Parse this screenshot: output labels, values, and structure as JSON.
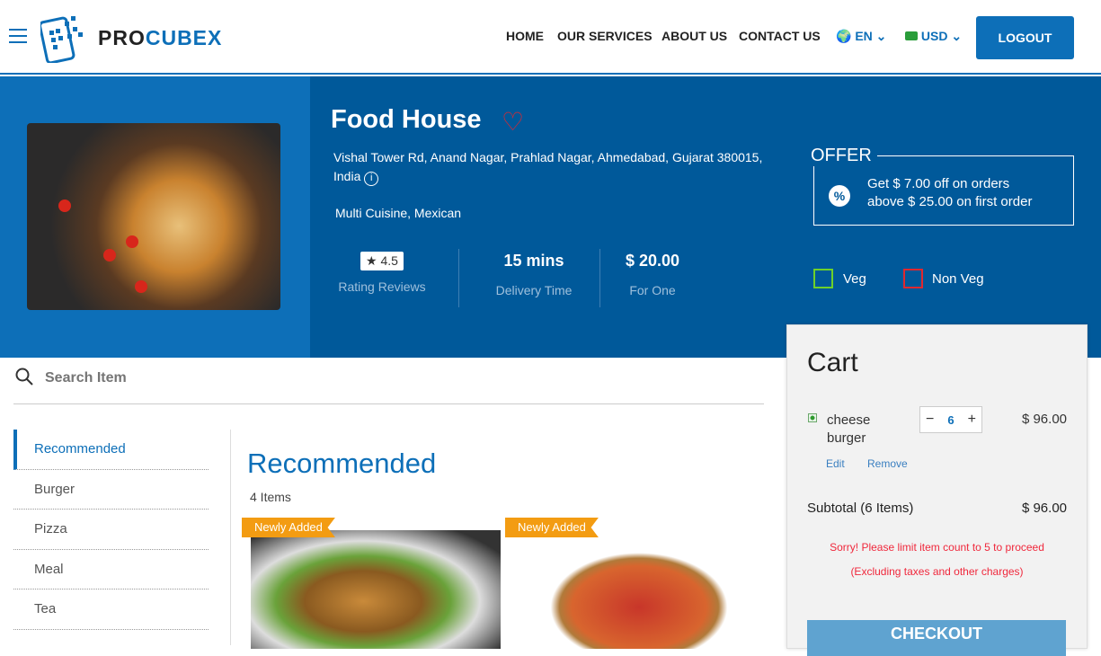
{
  "header": {
    "brand_a": "PRO",
    "brand_b": "CUBEX",
    "nav": [
      "HOME",
      "OUR SERVICES",
      "ABOUT US",
      "CONTACT US"
    ],
    "language": "EN",
    "currency": "USD",
    "logout": "LOGOUT"
  },
  "restaurant": {
    "name": "Food House",
    "address_line1": "Vishal Tower Rd, Anand Nagar, Prahlad Nagar, Ahmedabad, Gujarat 380015,",
    "address_line2": "India",
    "cuisine": "Multi Cuisine, Mexican",
    "rating": "4.5",
    "rating_label": "Rating Reviews",
    "delivery": "15 mins",
    "delivery_label": "Delivery Time",
    "price": "$ 20.00",
    "price_label": "For One"
  },
  "offer": {
    "title": "OFFER",
    "line1": "Get $ 7.00 off on orders",
    "line2": "above $ 25.00 on first order"
  },
  "filters": {
    "veg": "Veg",
    "nonveg": "Non Veg"
  },
  "search": {
    "placeholder": "Search Item"
  },
  "categories": [
    "Recommended",
    "Burger",
    "Pizza",
    "Meal",
    "Tea"
  ],
  "section": {
    "title": "Recommended",
    "count": "4 Items",
    "tag": "Newly Added"
  },
  "cart": {
    "title": "Cart",
    "item_name_1": "cheese",
    "item_name_2": "burger",
    "qty": "6",
    "item_price": "$ 96.00",
    "edit": "Edit",
    "remove": "Remove",
    "subtotal_label": "Subtotal (6 Items)",
    "subtotal": "$ 96.00",
    "error": "Sorry! Please limit item count to 5 to proceed",
    "note": "(Excluding taxes and other charges)",
    "checkout": "CHECKOUT"
  },
  "colors": {
    "primary": "#0d6fb8",
    "hero": "#00599a",
    "error": "#f0283c",
    "tag": "#f39c12"
  }
}
